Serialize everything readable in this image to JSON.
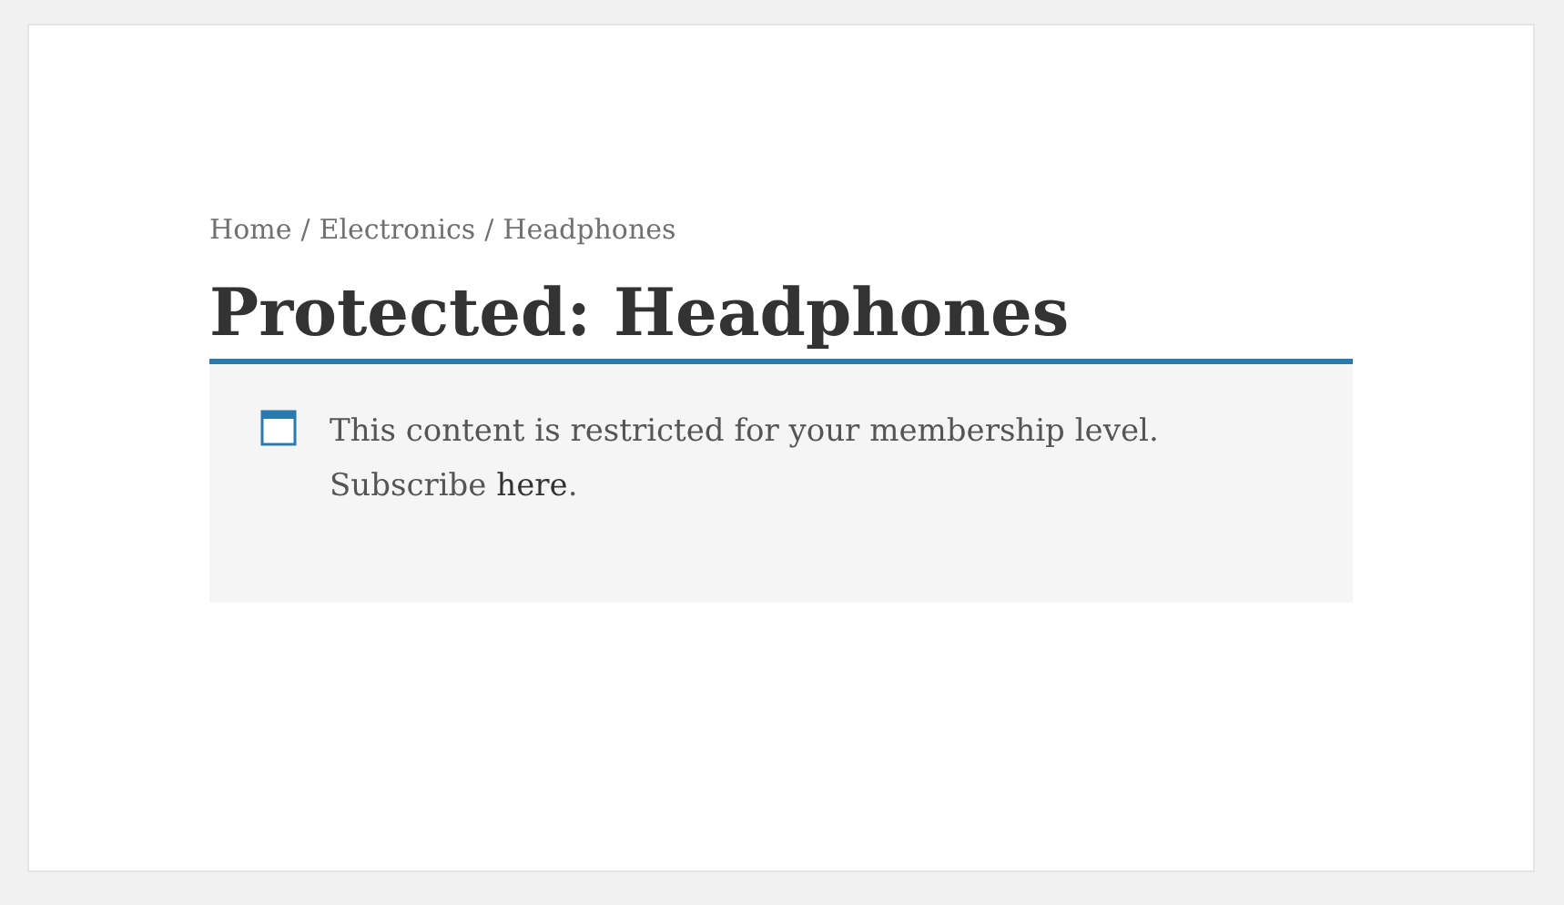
{
  "breadcrumb": [
    {
      "label": "Home"
    },
    {
      "label": "Electronics"
    },
    {
      "label": "Headphones"
    }
  ],
  "separator": "/",
  "title": "Protected: Headphones",
  "notice": {
    "text": "This content is restricted for your membership level. Subscribe ",
    "link": "here",
    "after": "."
  }
}
